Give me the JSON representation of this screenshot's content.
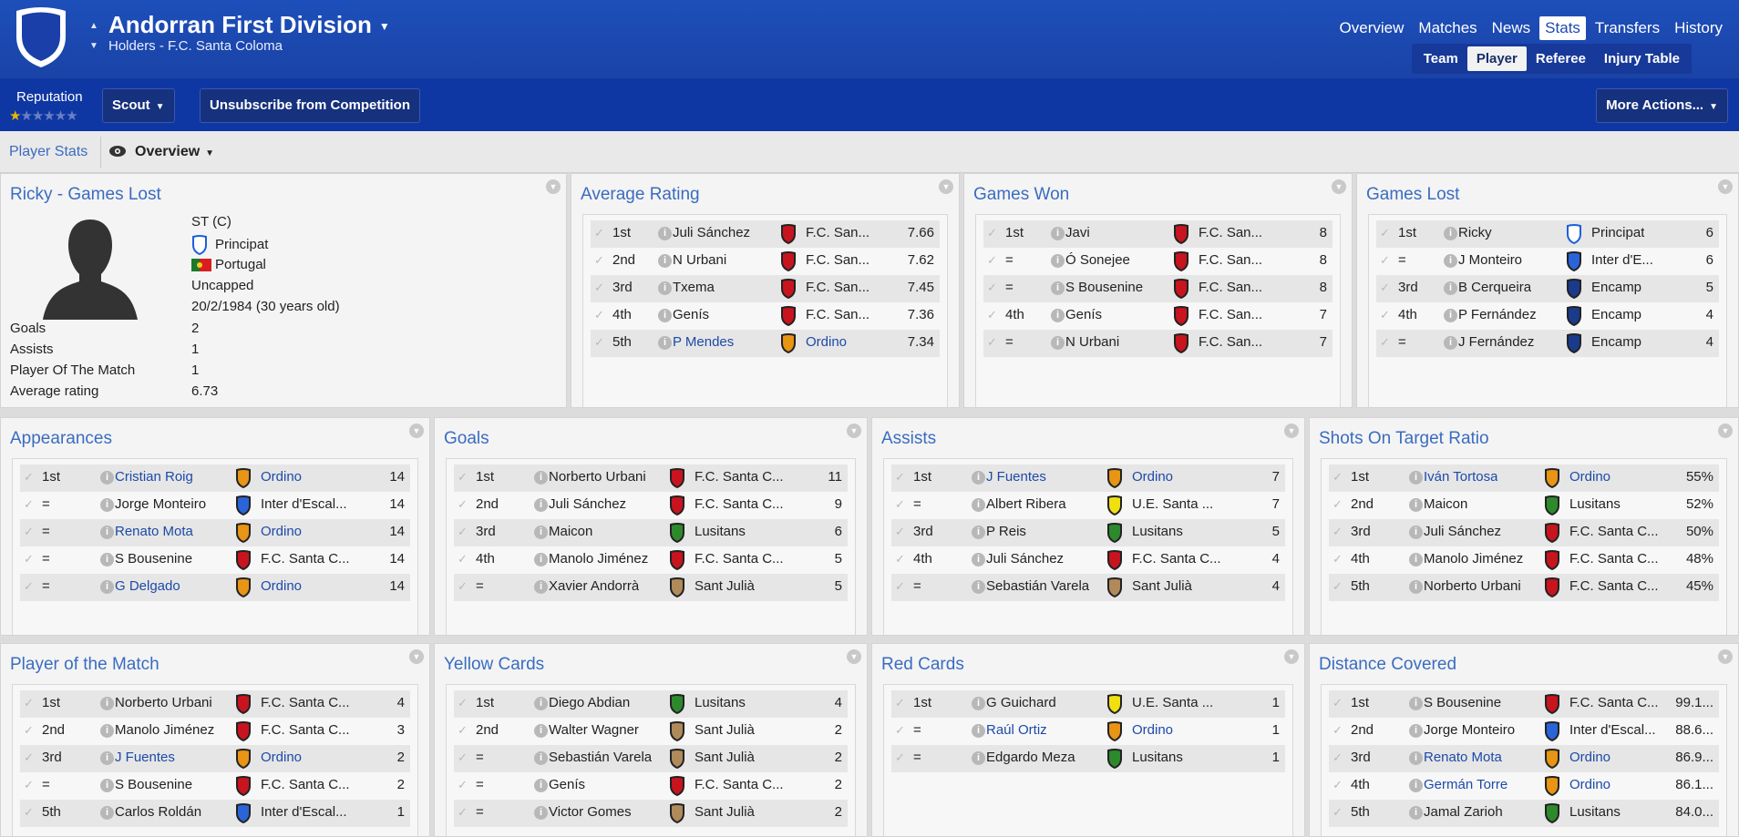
{
  "header": {
    "title": "Andorran First Division",
    "subtitle": "Holders - F.C. Santa Coloma",
    "nav": [
      "Overview",
      "Matches",
      "News",
      "Stats",
      "Transfers",
      "History"
    ],
    "nav_active": "Stats",
    "subnav": [
      "Team",
      "Player",
      "Referee",
      "Injury Table"
    ],
    "subnav_active": "Player"
  },
  "toolbar": {
    "reputation_label": "Reputation",
    "reputation_stars": 0.5,
    "scout_label": "Scout",
    "unsubscribe_label": "Unsubscribe from Competition",
    "more_actions_label": "More Actions..."
  },
  "statsbar": {
    "player_stats_label": "Player Stats",
    "view_label": "Overview"
  },
  "ricky": {
    "title": "Ricky - Games Lost",
    "position": "ST (C)",
    "club": "Principat",
    "nationality": "Portugal",
    "caps": "Uncapped",
    "dob": "20/2/1984 (30 years old)",
    "stats": [
      {
        "label": "Goals",
        "value": "2"
      },
      {
        "label": "Assists",
        "value": "1"
      },
      {
        "label": "Player Of The Match",
        "value": "1"
      },
      {
        "label": "Average rating",
        "value": "6.73"
      }
    ]
  },
  "crest_colors": {
    "red": "#c8141e",
    "orange": "#e89414",
    "blue-white": "#2a64d8",
    "blue": "#1a3a8c",
    "green": "#2c8a2c",
    "yellow": "#f0e010",
    "tan": "#b08a5a",
    "principat": "#ffffff"
  },
  "panels": {
    "average_rating": {
      "title": "Average Rating",
      "rows": [
        {
          "rank": "1st",
          "name": "Juli Sánchez",
          "club": "F.C. San...",
          "crest": "red",
          "value": "7.66",
          "link": false
        },
        {
          "rank": "2nd",
          "name": "N Urbani",
          "club": "F.C. San...",
          "crest": "red",
          "value": "7.62",
          "link": false
        },
        {
          "rank": "3rd",
          "name": "Txema",
          "club": "F.C. San...",
          "crest": "red",
          "value": "7.45",
          "link": false
        },
        {
          "rank": "4th",
          "name": "Genís",
          "club": "F.C. San...",
          "crest": "red",
          "value": "7.36",
          "link": false
        },
        {
          "rank": "5th",
          "name": "P Mendes",
          "club": "Ordino",
          "crest": "orange",
          "value": "7.34",
          "link": true
        }
      ]
    },
    "games_won": {
      "title": "Games Won",
      "rows": [
        {
          "rank": "1st",
          "name": "Javi",
          "club": "F.C. San...",
          "crest": "red",
          "value": "8",
          "link": false
        },
        {
          "rank": "=",
          "name": "Ó Sonejee",
          "club": "F.C. San...",
          "crest": "red",
          "value": "8",
          "link": false
        },
        {
          "rank": "=",
          "name": "S Bousenine",
          "club": "F.C. San...",
          "crest": "red",
          "value": "8",
          "link": false
        },
        {
          "rank": "4th",
          "name": "Genís",
          "club": "F.C. San...",
          "crest": "red",
          "value": "7",
          "link": false
        },
        {
          "rank": "=",
          "name": "N Urbani",
          "club": "F.C. San...",
          "crest": "red",
          "value": "7",
          "link": false
        }
      ]
    },
    "games_lost": {
      "title": "Games Lost",
      "rows": [
        {
          "rank": "1st",
          "name": "Ricky",
          "club": "Principat",
          "crest": "principat",
          "value": "6",
          "link": false
        },
        {
          "rank": "=",
          "name": "J Monteiro",
          "club": "Inter d'E...",
          "crest": "blue-white",
          "value": "6",
          "link": false
        },
        {
          "rank": "3rd",
          "name": "B Cerqueira",
          "club": "Encamp",
          "crest": "blue",
          "value": "5",
          "link": false
        },
        {
          "rank": "4th",
          "name": "P Fernández",
          "club": "Encamp",
          "crest": "blue",
          "value": "4",
          "link": false
        },
        {
          "rank": "=",
          "name": "J Fernández",
          "club": "Encamp",
          "crest": "blue",
          "value": "4",
          "link": false
        }
      ]
    },
    "appearances": {
      "title": "Appearances",
      "rows": [
        {
          "rank": "1st",
          "name": "Cristian Roig",
          "club": "Ordino",
          "crest": "orange",
          "value": "14",
          "link": true
        },
        {
          "rank": "=",
          "name": "Jorge Monteiro",
          "club": "Inter d'Escal...",
          "crest": "blue-white",
          "value": "14",
          "link": false
        },
        {
          "rank": "=",
          "name": "Renato Mota",
          "club": "Ordino",
          "crest": "orange",
          "value": "14",
          "link": true
        },
        {
          "rank": "=",
          "name": "S Bousenine",
          "club": "F.C. Santa C...",
          "crest": "red",
          "value": "14",
          "link": false
        },
        {
          "rank": "=",
          "name": "G Delgado",
          "club": "Ordino",
          "crest": "orange",
          "value": "14",
          "link": true
        }
      ]
    },
    "goals": {
      "title": "Goals",
      "rows": [
        {
          "rank": "1st",
          "name": "Norberto Urbani",
          "club": "F.C. Santa C...",
          "crest": "red",
          "value": "11",
          "link": false
        },
        {
          "rank": "2nd",
          "name": "Juli Sánchez",
          "club": "F.C. Santa C...",
          "crest": "red",
          "value": "9",
          "link": false
        },
        {
          "rank": "3rd",
          "name": "Maicon",
          "club": "Lusitans",
          "crest": "green",
          "value": "6",
          "link": false
        },
        {
          "rank": "4th",
          "name": "Manolo Jiménez",
          "club": "F.C. Santa C...",
          "crest": "red",
          "value": "5",
          "link": false
        },
        {
          "rank": "=",
          "name": "Xavier Andorrà",
          "club": "Sant Julià",
          "crest": "tan",
          "value": "5",
          "link": false
        }
      ]
    },
    "assists": {
      "title": "Assists",
      "rows": [
        {
          "rank": "1st",
          "name": "J Fuentes",
          "club": "Ordino",
          "crest": "orange",
          "value": "7",
          "link": true
        },
        {
          "rank": "=",
          "name": "Albert Ribera",
          "club": "U.E. Santa ...",
          "crest": "yellow",
          "value": "7",
          "link": false
        },
        {
          "rank": "3rd",
          "name": "P Reis",
          "club": "Lusitans",
          "crest": "green",
          "value": "5",
          "link": false
        },
        {
          "rank": "4th",
          "name": "Juli Sánchez",
          "club": "F.C. Santa C...",
          "crest": "red",
          "value": "4",
          "link": false
        },
        {
          "rank": "=",
          "name": "Sebastián Varela",
          "club": "Sant Julià",
          "crest": "tan",
          "value": "4",
          "link": false
        }
      ]
    },
    "shots_on_target": {
      "title": "Shots On Target Ratio",
      "rows": [
        {
          "rank": "1st",
          "name": "Iván Tortosa",
          "club": "Ordino",
          "crest": "orange",
          "value": "55%",
          "link": true
        },
        {
          "rank": "2nd",
          "name": "Maicon",
          "club": "Lusitans",
          "crest": "green",
          "value": "52%",
          "link": false
        },
        {
          "rank": "3rd",
          "name": "Juli Sánchez",
          "club": "F.C. Santa C...",
          "crest": "red",
          "value": "50%",
          "link": false
        },
        {
          "rank": "4th",
          "name": "Manolo Jiménez",
          "club": "F.C. Santa C...",
          "crest": "red",
          "value": "48%",
          "link": false
        },
        {
          "rank": "5th",
          "name": "Norberto Urbani",
          "club": "F.C. Santa C...",
          "crest": "red",
          "value": "45%",
          "link": false
        }
      ]
    },
    "player_of_match": {
      "title": "Player of the Match",
      "rows": [
        {
          "rank": "1st",
          "name": "Norberto Urbani",
          "club": "F.C. Santa C...",
          "crest": "red",
          "value": "4",
          "link": false
        },
        {
          "rank": "2nd",
          "name": "Manolo Jiménez",
          "club": "F.C. Santa C...",
          "crest": "red",
          "value": "3",
          "link": false
        },
        {
          "rank": "3rd",
          "name": "J Fuentes",
          "club": "Ordino",
          "crest": "orange",
          "value": "2",
          "link": true
        },
        {
          "rank": "=",
          "name": "S Bousenine",
          "club": "F.C. Santa C...",
          "crest": "red",
          "value": "2",
          "link": false
        },
        {
          "rank": "5th",
          "name": "Carlos Roldán",
          "club": "Inter d'Escal...",
          "crest": "blue-white",
          "value": "1",
          "link": false
        }
      ]
    },
    "yellow_cards": {
      "title": "Yellow Cards",
      "rows": [
        {
          "rank": "1st",
          "name": "Diego Abdian",
          "club": "Lusitans",
          "crest": "green",
          "value": "4",
          "link": false
        },
        {
          "rank": "2nd",
          "name": "Walter Wagner",
          "club": "Sant Julià",
          "crest": "tan",
          "value": "2",
          "link": false
        },
        {
          "rank": "=",
          "name": "Sebastián Varela",
          "club": "Sant Julià",
          "crest": "tan",
          "value": "2",
          "link": false
        },
        {
          "rank": "=",
          "name": "Genís",
          "club": "F.C. Santa C...",
          "crest": "red",
          "value": "2",
          "link": false
        },
        {
          "rank": "=",
          "name": "Victor Gomes",
          "club": "Sant Julià",
          "crest": "tan",
          "value": "2",
          "link": false
        }
      ]
    },
    "red_cards": {
      "title": "Red Cards",
      "rows": [
        {
          "rank": "1st",
          "name": "G Guichard",
          "club": "U.E. Santa ...",
          "crest": "yellow",
          "value": "1",
          "link": false
        },
        {
          "rank": "=",
          "name": "Raúl Ortiz",
          "club": "Ordino",
          "crest": "orange",
          "value": "1",
          "link": true
        },
        {
          "rank": "=",
          "name": "Edgardo Meza",
          "club": "Lusitans",
          "crest": "green",
          "value": "1",
          "link": false
        }
      ]
    },
    "distance_covered": {
      "title": "Distance Covered",
      "rows": [
        {
          "rank": "1st",
          "name": "S Bousenine",
          "club": "F.C. Santa C...",
          "crest": "red",
          "value": "99.1...",
          "link": false
        },
        {
          "rank": "2nd",
          "name": "Jorge Monteiro",
          "club": "Inter d'Escal...",
          "crest": "blue-white",
          "value": "88.6...",
          "link": false
        },
        {
          "rank": "3rd",
          "name": "Renato Mota",
          "club": "Ordino",
          "crest": "orange",
          "value": "86.9...",
          "link": true
        },
        {
          "rank": "4th",
          "name": "Germán Torre",
          "club": "Ordino",
          "crest": "orange",
          "value": "86.1...",
          "link": true
        },
        {
          "rank": "5th",
          "name": "Jamal Zarioh",
          "club": "Lusitans",
          "crest": "green",
          "value": "84.0...",
          "link": false
        }
      ]
    }
  }
}
